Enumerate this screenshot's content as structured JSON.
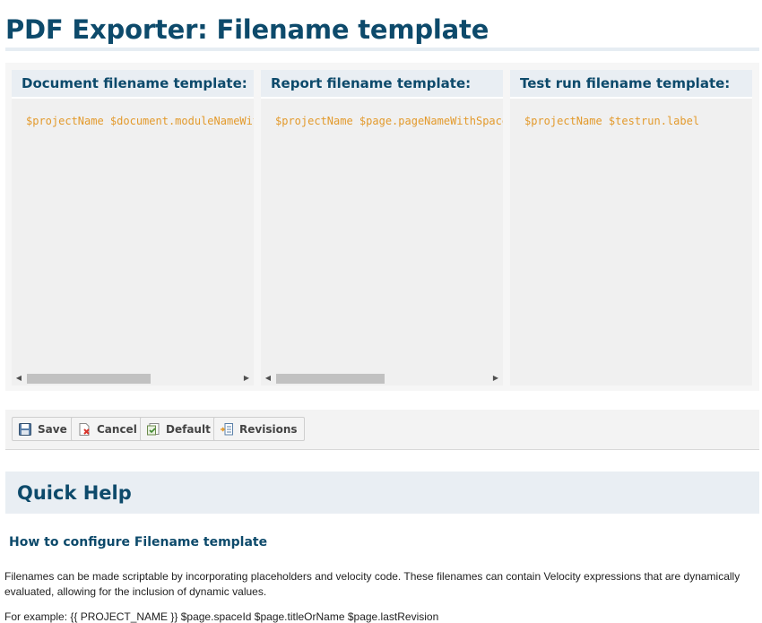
{
  "page": {
    "title": "PDF Exporter: Filename template"
  },
  "panels": [
    {
      "header": "Document filename template:",
      "code": "$projectName $document.moduleNameWithSpace"
    },
    {
      "header": "Report filename template:",
      "code": "$projectName $page.pageNameWithSpace"
    },
    {
      "header": "Test run filename template:",
      "code": "$projectName $testrun.label"
    }
  ],
  "toolbar": {
    "save": "Save",
    "cancel": "Cancel",
    "default": "Default",
    "revisions": "Revisions"
  },
  "quick_help": {
    "title": "Quick Help",
    "heading": "How to configure Filename template",
    "paragraph": "Filenames can be made scriptable by incorporating placeholders and velocity code. These filenames can contain Velocity expressions that are dynamically evaluated, allowing for the inclusion of dynamic values.",
    "example": "For example: {{ PROJECT_NAME }} $page.spaceId $page.titleOrName $page.lastRevision"
  },
  "icons": {
    "save": "floppy-disk-icon",
    "cancel": "cancel-document-icon",
    "default": "default-reset-icon",
    "revisions": "revisions-icon"
  },
  "colors": {
    "title": "#0d4a6b",
    "code": "#e39a2c",
    "header_bg": "#e9eef3"
  }
}
